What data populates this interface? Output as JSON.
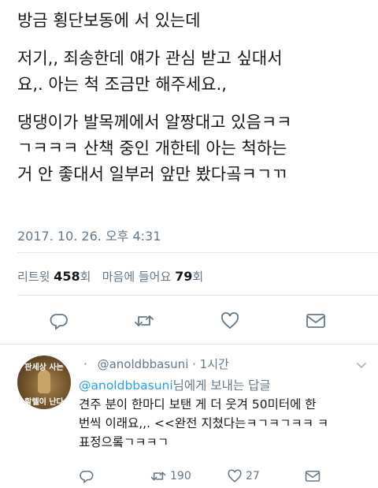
{
  "tweet": {
    "line1": "방금 횡단보동에 서 있는데",
    "line2": "저기,, 죄송한데 얘가 관심 받고 싶대서",
    "line3": "요,. 아는 척 조금만 해주세요.,",
    "line4": "댕댕이가 발목께에서 알짱대고 있음ㅋㅋ",
    "line5": "ㄱㅋㅋㅋ 산책 중인 개한테 아는 척하는",
    "line6": "거 안 좋대서 일부러 앞만 봤다곸ㅋㄱㄲ",
    "timestamp": "2017. 10. 26. 오후 4:31"
  },
  "stats": {
    "retweets_label": "리트윗",
    "retweets_count": "458",
    "retweets_unit": "회",
    "likes_label": "마음에 들어요",
    "likes_count": "79",
    "likes_unit": "회"
  },
  "icons": {
    "reply": "reply-icon",
    "retweet": "retweet-icon",
    "like": "heart-icon",
    "dm": "envelope-icon",
    "caret": "chevron-down-icon"
  },
  "colors": {
    "accent": "#1da1f2",
    "secondary_text": "#657786",
    "divider": "#e1e8ed"
  },
  "reply": {
    "avatar_caption_top": "판세상 사는",
    "avatar_caption_bottom": "할렐이 난다",
    "dot": "·",
    "handle": "@anoldbbasuni",
    "time": "· 1시간",
    "replying_handle": "@anoldbbasuni",
    "replying_suffix": "님에게 보내는 답글",
    "line1": "견주 분이 한마디 보탠 게 더 웃겨 50미터에 한",
    "line2": "번씩 이래요,,. <<완전 지쳤다는ㅋㄱㅋㄱㅋㅋ ㅋ",
    "line3": "표정으롴ㄱㅋㅋㄱ",
    "retweet_count": "190",
    "like_count": "27"
  }
}
